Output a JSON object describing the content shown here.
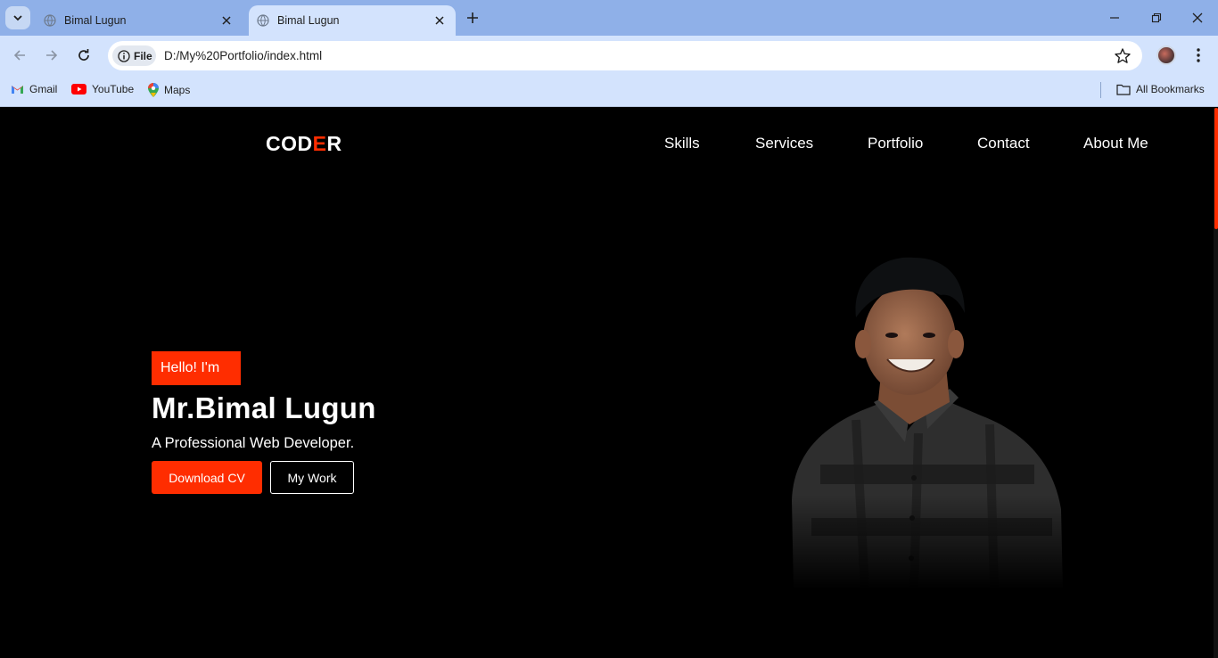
{
  "browser": {
    "tabs": [
      {
        "title": "Bimal Lugun",
        "active": false
      },
      {
        "title": "Bimal Lugun",
        "active": true
      }
    ],
    "address": {
      "scheme_chip": "File",
      "url": "D:/My%20Portfolio/index.html"
    },
    "bookmarks": [
      {
        "label": "Gmail",
        "icon": "gmail-icon"
      },
      {
        "label": "YouTube",
        "icon": "youtube-icon"
      },
      {
        "label": "Maps",
        "icon": "maps-icon"
      }
    ],
    "all_bookmarks_label": "All Bookmarks"
  },
  "site": {
    "logo": {
      "part1": "COD",
      "accent": "E",
      "part2": "R"
    },
    "nav": [
      "Skills",
      "Services",
      "Portfolio",
      "Contact",
      "About Me"
    ],
    "hero": {
      "greeting": "Hello! I'm",
      "name": "Mr.Bimal Lugun",
      "tagline": "A Professional Web Developer.",
      "primary_button": "Download CV",
      "secondary_button": "My Work"
    }
  },
  "colors": {
    "accent": "#ff2d00",
    "background": "#000000",
    "chrome": "#d3e3fd",
    "tabstrip": "#8fb0e8"
  }
}
